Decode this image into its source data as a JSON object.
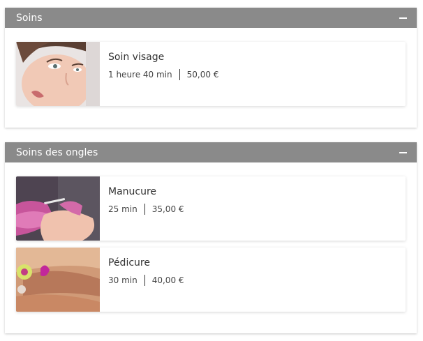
{
  "sections": [
    {
      "title": "Soins",
      "collapse_icon": "minus-icon",
      "services": [
        {
          "name": "Soin visage",
          "duration": "1 heure 40 min",
          "price": "50,00 €",
          "image": "face-portrait-photo"
        }
      ]
    },
    {
      "title": "Soins des ongles",
      "collapse_icon": "minus-icon",
      "services": [
        {
          "name": "Manucure",
          "duration": "25 min",
          "price": "35,00 €",
          "image": "manicure-photo"
        },
        {
          "name": "Pédicure",
          "duration": "30 min",
          "price": "40,00 €",
          "image": "pedicure-photo"
        }
      ]
    }
  ],
  "colors": {
    "header_bg": "#8a8a8a",
    "header_text": "#ffffff",
    "card_bg": "#ffffff",
    "text": "#333333"
  }
}
